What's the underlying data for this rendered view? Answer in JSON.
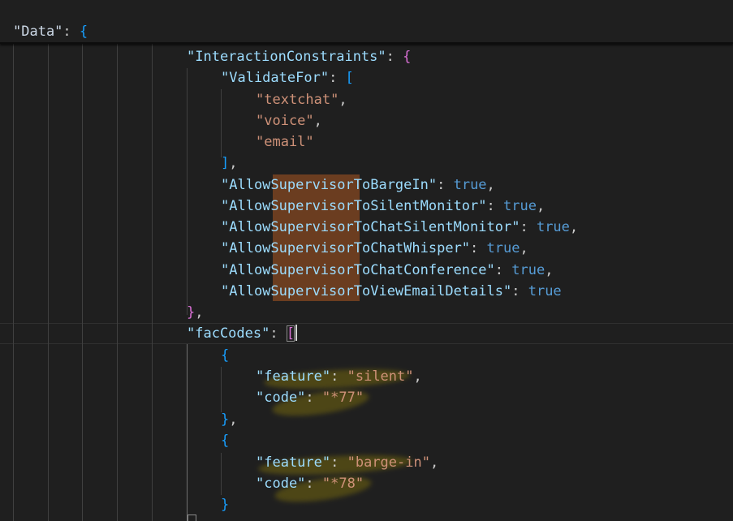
{
  "editor": {
    "sticky": {
      "key": "\"Data\"",
      "colon": ": ",
      "brace": "{"
    },
    "interaction_constraints": {
      "key": "\"InteractionConstraints\"",
      "validate_for_key": "\"ValidateFor\"",
      "validate_for_values": [
        "\"textchat\"",
        "\"voice\"",
        "\"email\""
      ],
      "flags": [
        {
          "key": "\"AllowSupervisorToBargeIn\"",
          "value": "true",
          "comma": ","
        },
        {
          "key": "\"AllowSupervisorToSilentMonitor\"",
          "value": "true",
          "comma": ","
        },
        {
          "key": "\"AllowSupervisorToChatSilentMonitor\"",
          "value": "true",
          "comma": ","
        },
        {
          "key": "\"AllowSupervisorToChatWhisper\"",
          "value": "true",
          "comma": ","
        },
        {
          "key": "\"AllowSupervisorToChatConference\"",
          "value": "true",
          "comma": ","
        },
        {
          "key": "\"AllowSupervisorToViewEmailDetails\"",
          "value": "true",
          "comma": ""
        }
      ]
    },
    "fac_codes": {
      "key": "\"facCodes\"",
      "entries": [
        {
          "feature_key": "\"feature\"",
          "feature_value": "\"silent\"",
          "code_key": "\"code\"",
          "code_value": "\"*77\""
        },
        {
          "feature_key": "\"feature\"",
          "feature_value": "\"barge-in\"",
          "code_key": "\"code\"",
          "code_value": "\"*78\""
        }
      ]
    },
    "highlighted_match": "Supervisor",
    "colors": {
      "background": "#1f1f1f",
      "property_key": "#9cdcfe",
      "string_value": "#ce9178",
      "boolean_value": "#569cd6",
      "bracket_level_1": "#179fff",
      "bracket_level_2": "#da70d6",
      "selection_highlight": "#6b3d20"
    }
  }
}
